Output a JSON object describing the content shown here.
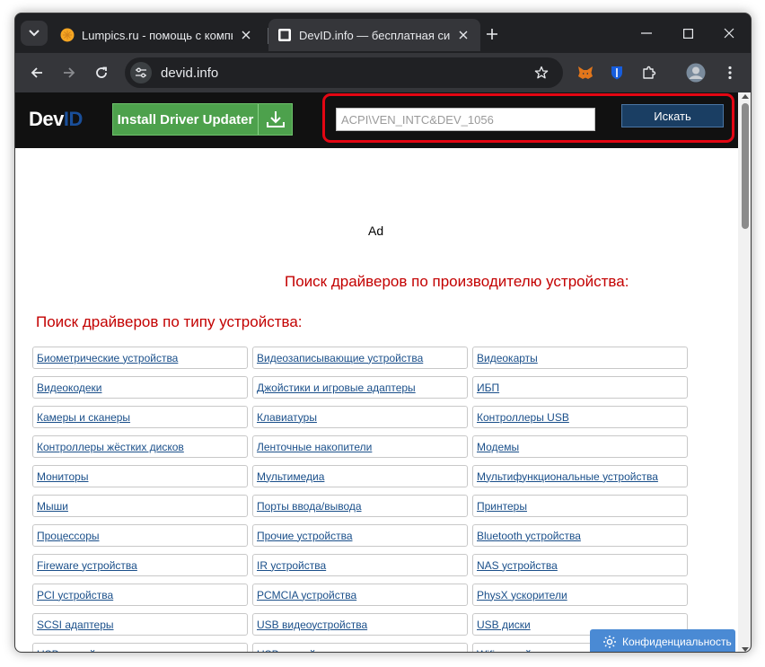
{
  "browser": {
    "tabs": [
      {
        "title": "Lumpics.ru - помощь с компьютером",
        "active": false
      },
      {
        "title": "DevID.info — бесплатная система",
        "active": true
      }
    ],
    "address": "devid.info"
  },
  "site": {
    "logo": {
      "part1": "Dev",
      "part2": "ID"
    },
    "install_button": "Install Driver Updater",
    "search_input_value": "ACPI\\VEN_INTC&DEV_1056",
    "search_button": "Искать",
    "ad_label": "Ad",
    "vendor_heading": "Поиск драйверов по производителю устройства:",
    "type_heading": "Поиск драйверов по типу устройства:",
    "categories": [
      [
        "Биометрические устройства",
        "Видеозаписывающие устройства",
        "Видеокарты"
      ],
      [
        "Видеокодеки",
        "Джойстики и игровые адаптеры",
        "ИБП"
      ],
      [
        "Камеры и сканеры",
        "Клавиатуры",
        "Контроллеры USB"
      ],
      [
        "Контроллеры жёстких дисков",
        "Ленточные накопители",
        "Модемы"
      ],
      [
        "Мониторы",
        "Мультимедиа",
        "Мультифункциональные устройства"
      ],
      [
        "Мыши",
        "Порты ввода/вывода",
        "Принтеры"
      ],
      [
        "Процессоры",
        "Прочие устройства",
        "Bluetooth устройства"
      ],
      [
        "Fireware устройства",
        "IR устройства",
        "NAS устройства"
      ],
      [
        "PCI устройства",
        "PCMCIA устройства",
        "PhysX ускорители"
      ],
      [
        "SCSI адаптеры",
        "USB видеоустройства",
        "USB диски"
      ],
      [
        "USB устройства",
        "USB устройства ввода",
        "Wifi устройства"
      ]
    ],
    "privacy_button": "Конфиденциальность"
  },
  "colors": {
    "heading_red": "#c30000",
    "link_blue": "#1a4f8a",
    "highlight_red": "#e30613",
    "install_green": "#4da14c",
    "search_btn_blue": "#1a3e63"
  }
}
